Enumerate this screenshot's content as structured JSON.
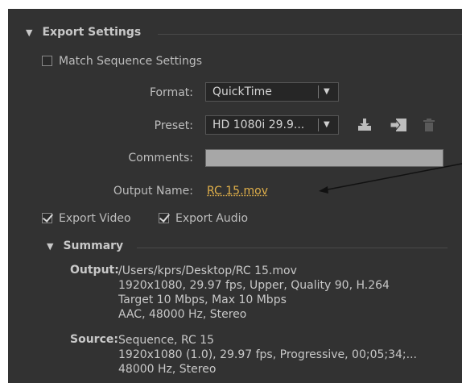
{
  "export_settings": {
    "title": "Export Settings",
    "match_sequence_label": "Match Sequence Settings",
    "match_sequence_checked": false,
    "format_label": "Format:",
    "format_value": "QuickTime",
    "preset_label": "Preset:",
    "preset_value": "HD 1080i 29.9...",
    "comments_label": "Comments:",
    "comments_value": "",
    "output_name_label": "Output Name:",
    "output_name_value": "RC 15.mov",
    "export_video_label": "Export Video",
    "export_video_checked": true,
    "export_audio_label": "Export Audio",
    "export_audio_checked": true
  },
  "summary": {
    "title": "Summary",
    "output_label": "Output:",
    "output_lines": [
      "/Users/kprs/Desktop/RC 15.mov",
      "1920x1080, 29.97 fps, Upper, Quality 90, H.264",
      "Target 10 Mbps, Max 10 Mbps",
      "AAC, 48000 Hz, Stereo"
    ],
    "source_label": "Source:",
    "source_lines": [
      "Sequence, RC 15",
      "1920x1080 (1.0), 29.97 fps, Progressive, 00;05;34;...",
      "48000 Hz, Stereo"
    ]
  },
  "icons": {
    "preset_save": "save-preset-icon",
    "preset_import": "import-preset-icon",
    "preset_delete": "delete-preset-icon"
  },
  "colors": {
    "panel_bg": "#323232",
    "link": "#e0b04a",
    "text": "#bdbdbd"
  }
}
